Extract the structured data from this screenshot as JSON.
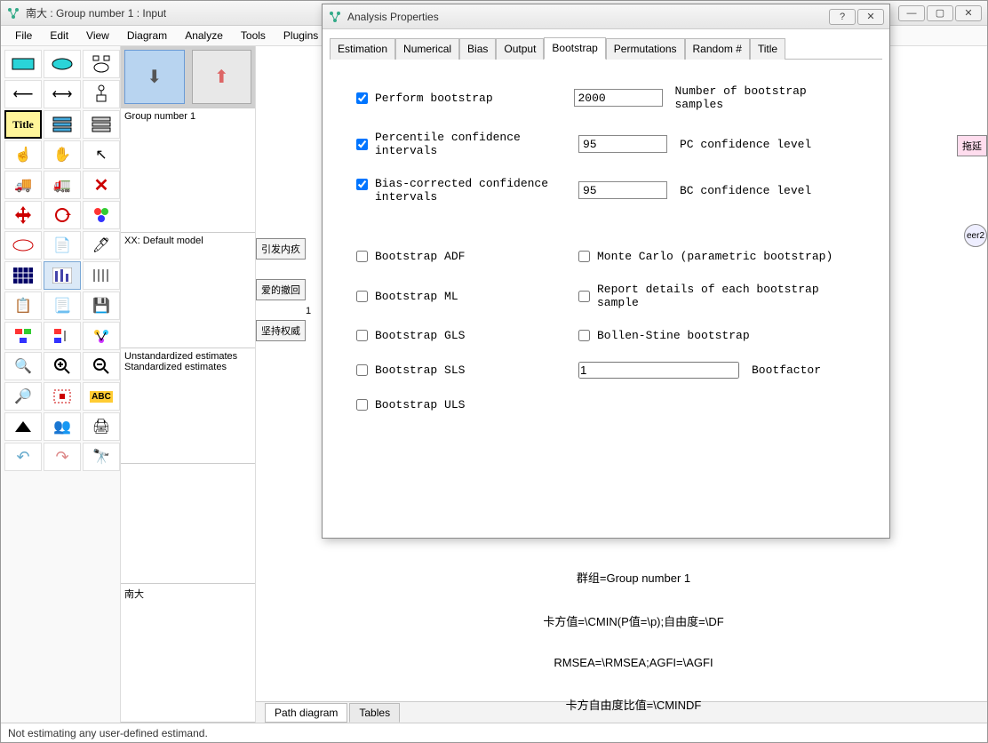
{
  "main_window": {
    "title": "南大 : Group number 1 : Input"
  },
  "menubar": [
    "File",
    "Edit",
    "View",
    "Diagram",
    "Analyze",
    "Tools",
    "Plugins"
  ],
  "left_panels": {
    "group": "Group number 1",
    "model": "XX: Default model",
    "estimates": [
      "Unstandardized estimates",
      "Standardized estimates"
    ],
    "misc2": "南大"
  },
  "canvas": {
    "nodes": [
      "引发内疚",
      "爱的撤回",
      "坚持权威"
    ],
    "right_nodes": [
      "拖延",
      "eer2"
    ],
    "text_lines": [
      "群组=Group number 1",
      "卡方值=\\CMIN(P值=\\p);自由度=\\DF",
      "RMSEA=\\RMSEA;AGFI=\\AGFI",
      "卡方自由度比值=\\CMINDF"
    ],
    "one_label": "1"
  },
  "bottom_tabs": {
    "path": "Path diagram",
    "tables": "Tables"
  },
  "status": "Not estimating any user-defined estimand.",
  "dialog": {
    "title": "Analysis Properties",
    "tabs": [
      "Estimation",
      "Numerical",
      "Bias",
      "Output",
      "Bootstrap",
      "Permutations",
      "Random #",
      "Title"
    ],
    "active_tab": "Bootstrap",
    "fields": {
      "perform_bootstrap": {
        "label": "Perform bootstrap",
        "checked": true
      },
      "num_samples": {
        "value": "2000",
        "label": "Number of bootstrap samples"
      },
      "percentile_ci": {
        "label": "Percentile confidence intervals",
        "checked": true
      },
      "pc_level": {
        "value": "95",
        "label": "PC confidence level"
      },
      "bias_corr": {
        "label": "Bias-corrected confidence intervals",
        "checked": true
      },
      "bc_level": {
        "value": "95",
        "label": "BC confidence level"
      },
      "boot_adf": {
        "label": "Bootstrap ADF",
        "checked": false
      },
      "monte_carlo": {
        "label": "Monte Carlo (parametric bootstrap)",
        "checked": false
      },
      "boot_ml": {
        "label": "Bootstrap ML",
        "checked": false
      },
      "report_details": {
        "label": "Report details of each bootstrap sample",
        "checked": false
      },
      "boot_gls": {
        "label": "Bootstrap GLS",
        "checked": false
      },
      "bollen_stine": {
        "label": "Bollen-Stine bootstrap",
        "checked": false
      },
      "boot_sls": {
        "label": "Bootstrap SLS",
        "checked": false
      },
      "bootfactor": {
        "value": "1",
        "label": "Bootfactor"
      },
      "boot_uls": {
        "label": "Bootstrap ULS",
        "checked": false
      }
    }
  },
  "toolbox_icons": [
    "rect",
    "ellipse",
    "latent",
    "←",
    "↔",
    "indicator",
    "Title",
    "stack1",
    "stack2",
    "hand",
    "grab",
    "cursor",
    "truck1",
    "truck2",
    "x",
    "move",
    "rotate",
    "color",
    "oval",
    "page",
    "pen",
    "grid",
    "bars",
    "lines",
    "clip",
    "sheet",
    "save",
    "t1",
    "t2",
    "t3",
    "m+",
    "m+",
    "m-",
    "s1",
    "s2",
    "s3",
    "tri",
    "p1",
    "print",
    "undo",
    "redo",
    "find"
  ]
}
